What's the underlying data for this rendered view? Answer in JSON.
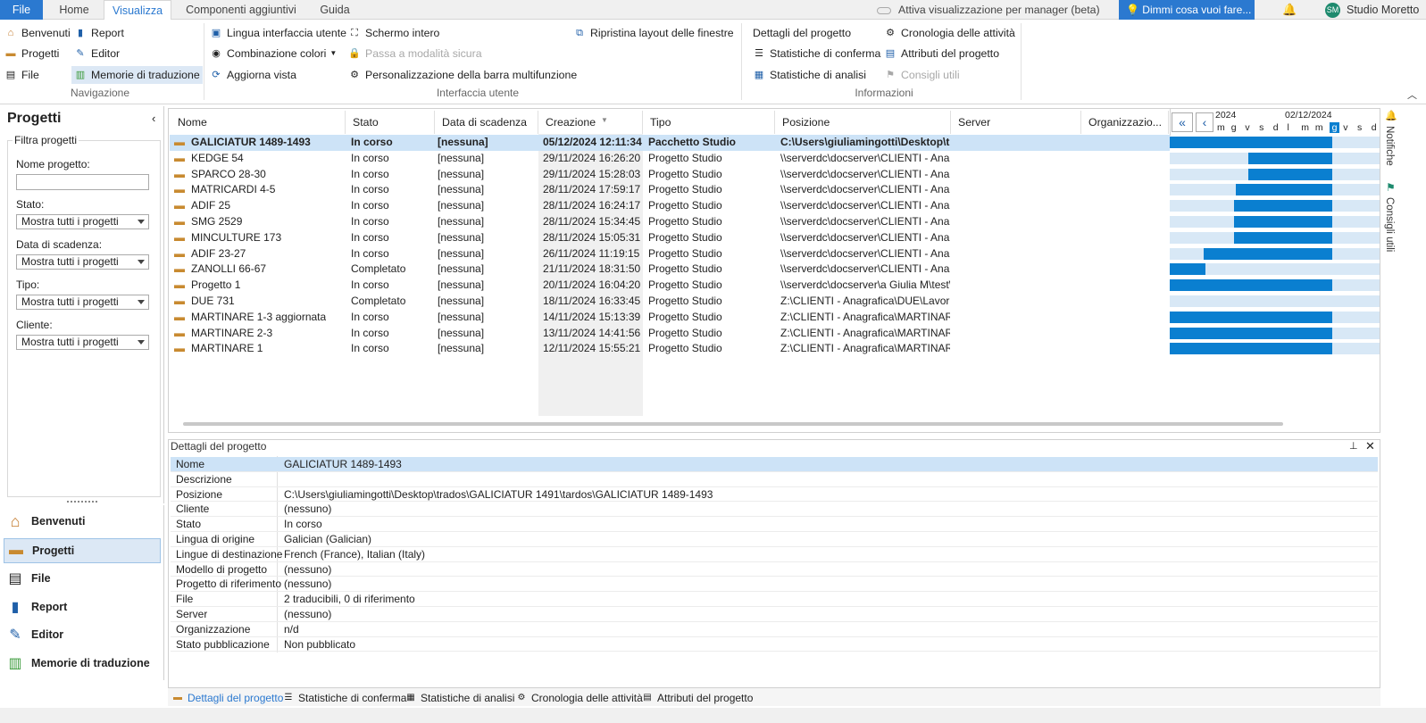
{
  "tabs": {
    "file": "File",
    "home": "Home",
    "view": "Visualizza",
    "addins": "Componenti aggiuntivi",
    "help": "Guida"
  },
  "top": {
    "manager_toggle": "Attiva visualizzazione per manager (beta)",
    "tellme": "Dimmi cosa vuoi fare...",
    "user_initials": "SM",
    "user_name": "Studio Moretto"
  },
  "ribbon": {
    "nav": {
      "benvenuti": "Benvenuti",
      "progetti": "Progetti",
      "file": "File",
      "report": "Report",
      "editor": "Editor",
      "memorie": "Memorie di traduzione",
      "label": "Navigazione"
    },
    "ui": {
      "lingua": "Lingua interfaccia utente",
      "combinazione": "Combinazione colori",
      "aggiorna": "Aggiorna vista",
      "schermo": "Schermo intero",
      "sicura": "Passa a modalità sicura",
      "personalizza": "Personalizzazione della barra multifunzione",
      "ripristina": "Ripristina layout delle finestre",
      "label": "Interfaccia utente"
    },
    "info": {
      "dettagli": "Dettagli del progetto",
      "conferma": "Statistiche di conferma",
      "analisi": "Statistiche di analisi",
      "cronologia": "Cronologia delle attività",
      "attributi": "Attributi del progetto",
      "consigli": "Consigli utili",
      "label": "Informazioni"
    }
  },
  "left": {
    "title": "Progetti",
    "filter": "Filtra progetti",
    "nome_label": "Nome progetto:",
    "nome_value": "",
    "stato_label": "Stato:",
    "scadenza_label": "Data di scadenza:",
    "tipo_label": "Tipo:",
    "cliente_label": "Cliente:",
    "select_value": "Mostra tutti i progetti"
  },
  "nav": {
    "benvenuti": "Benvenuti",
    "progetti": "Progetti",
    "file": "File",
    "report": "Report",
    "editor": "Editor",
    "memorie": "Memorie di traduzione"
  },
  "grid": {
    "headers": [
      "Nome",
      "Stato",
      "Data di scadenza",
      "Creazione",
      "Tipo",
      "Posizione",
      "Server",
      "Organizzazio..."
    ],
    "gantt_months": [
      "2024",
      "02/12/2024"
    ],
    "gantt_days": [
      "m",
      "g",
      "v",
      "s",
      "d",
      "l",
      "m",
      "m",
      "g",
      "v",
      "s",
      "d"
    ],
    "rows": [
      [
        "GALICIATUR 1489-1493",
        "In corso",
        "[nessuna]",
        "05/12/2024 12:11:34",
        "Pacchetto Studio",
        "C:\\Users\\giuliamingotti\\Desktop\\tra..."
      ],
      [
        "KEDGE 54",
        "In corso",
        "[nessuna]",
        "29/11/2024 16:26:20",
        "Progetto Studio",
        "\\\\serverdc\\docserver\\CLIENTI - Ana..."
      ],
      [
        "SPARCO 28-30",
        "In corso",
        "[nessuna]",
        "29/11/2024 15:28:03",
        "Progetto Studio",
        "\\\\serverdc\\docserver\\CLIENTI - Ana..."
      ],
      [
        "MATRICARDI 4-5",
        "In corso",
        "[nessuna]",
        "28/11/2024 17:59:17",
        "Progetto Studio",
        "\\\\serverdc\\docserver\\CLIENTI - Ana..."
      ],
      [
        "ADIF 25",
        "In corso",
        "[nessuna]",
        "28/11/2024 16:24:17",
        "Progetto Studio",
        "\\\\serverdc\\docserver\\CLIENTI - Ana..."
      ],
      [
        "SMG 2529",
        "In corso",
        "[nessuna]",
        "28/11/2024 15:34:45",
        "Progetto Studio",
        "\\\\serverdc\\docserver\\CLIENTI - Ana..."
      ],
      [
        "MINCULTURE 173",
        "In corso",
        "[nessuna]",
        "28/11/2024 15:05:31",
        "Progetto Studio",
        "\\\\serverdc\\docserver\\CLIENTI - Ana..."
      ],
      [
        "ADIF 23-27",
        "In corso",
        "[nessuna]",
        "26/11/2024 11:19:15",
        "Progetto Studio",
        "\\\\serverdc\\docserver\\CLIENTI - Ana..."
      ],
      [
        "ZANOLLI 66-67",
        "Completato",
        "[nessuna]",
        "21/11/2024 18:31:50",
        "Progetto Studio",
        "\\\\serverdc\\docserver\\CLIENTI - Ana..."
      ],
      [
        "Progetto 1",
        "In corso",
        "[nessuna]",
        "20/11/2024 16:04:20",
        "Progetto Studio",
        "\\\\serverdc\\docserver\\a Giulia M\\test\\..."
      ],
      [
        "DUE 731",
        "Completato",
        "[nessuna]",
        "18/11/2024 16:33:45",
        "Progetto Studio",
        "Z:\\CLIENTI - Anagrafica\\DUE\\Lavori ..."
      ],
      [
        "MARTINARE 1-3 aggiornata",
        "In corso",
        "[nessuna]",
        "14/11/2024 15:13:39",
        "Progetto Studio",
        "Z:\\CLIENTI - Anagrafica\\MARTINAR..."
      ],
      [
        "MARTINARE 2-3",
        "In corso",
        "[nessuna]",
        "13/11/2024 14:41:56",
        "Progetto Studio",
        "Z:\\CLIENTI - Anagrafica\\MARTINAR..."
      ],
      [
        "MARTINARE 1",
        "In corso",
        "[nessuna]",
        "12/11/2024 15:55:21",
        "Progetto Studio",
        "Z:\\CLIENTI - Anagrafica\\MARTINAR..."
      ]
    ]
  },
  "details": {
    "title": "Dettagli del progetto",
    "rows": [
      [
        "Nome",
        "GALICIATUR 1489-1493"
      ],
      [
        "Descrizione",
        ""
      ],
      [
        "Posizione",
        "C:\\Users\\giuliamingotti\\Desktop\\trados\\GALICIATUR 1491\\tardos\\GALICIATUR 1489-1493"
      ],
      [
        "Cliente",
        "(nessuno)"
      ],
      [
        "Stato",
        "In corso"
      ],
      [
        "Lingua di origine",
        "Galician (Galician)"
      ],
      [
        "Lingue di destinazione",
        "French (France), Italian (Italy)"
      ],
      [
        "Modello di progetto",
        "(nessuno)"
      ],
      [
        "Progetto di riferimento",
        "(nessuno)"
      ],
      [
        "File",
        "2 traducibili, 0 di riferimento"
      ],
      [
        "Server",
        "(nessuno)"
      ],
      [
        "Organizzazione",
        "n/d"
      ],
      [
        "Stato pubblicazione",
        "Non pubblicato"
      ]
    ]
  },
  "bottom_tabs": [
    "Dettagli del progetto",
    "Statistiche di conferma",
    "Statistiche di analisi",
    "Cronologia delle attività",
    "Attributi del progetto"
  ],
  "side": {
    "notifiche": "Notifiche",
    "consigli": "Consigli utili"
  }
}
